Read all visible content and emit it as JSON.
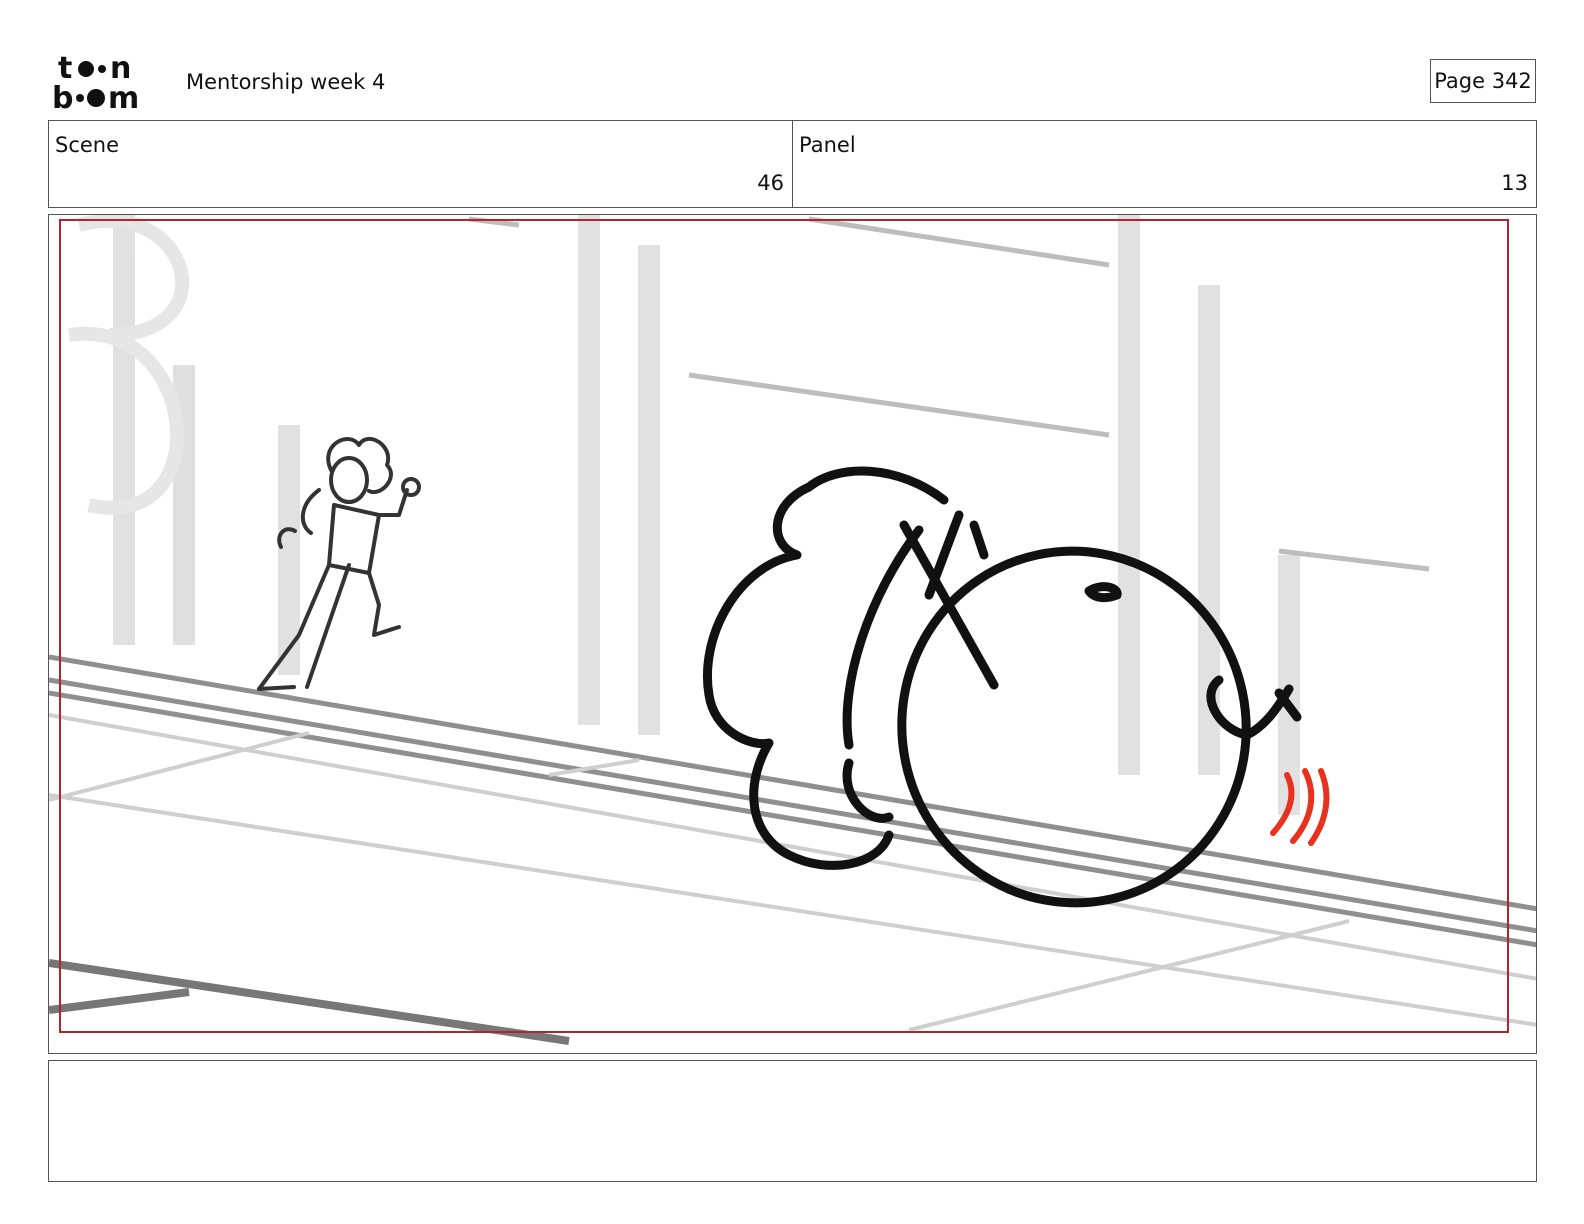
{
  "header": {
    "logo_text_top": "toon",
    "logo_text_bottom": "boom",
    "title": "Mentorship week 4",
    "page_label": "Page 342"
  },
  "info": {
    "scene_label": "Scene",
    "scene_value": "46",
    "panel_label": "Panel",
    "panel_value": "13"
  },
  "frame": {
    "safe_area_color": "#b0262c",
    "motion_line_color": "#e8321e"
  },
  "notes": {
    "text": ""
  }
}
